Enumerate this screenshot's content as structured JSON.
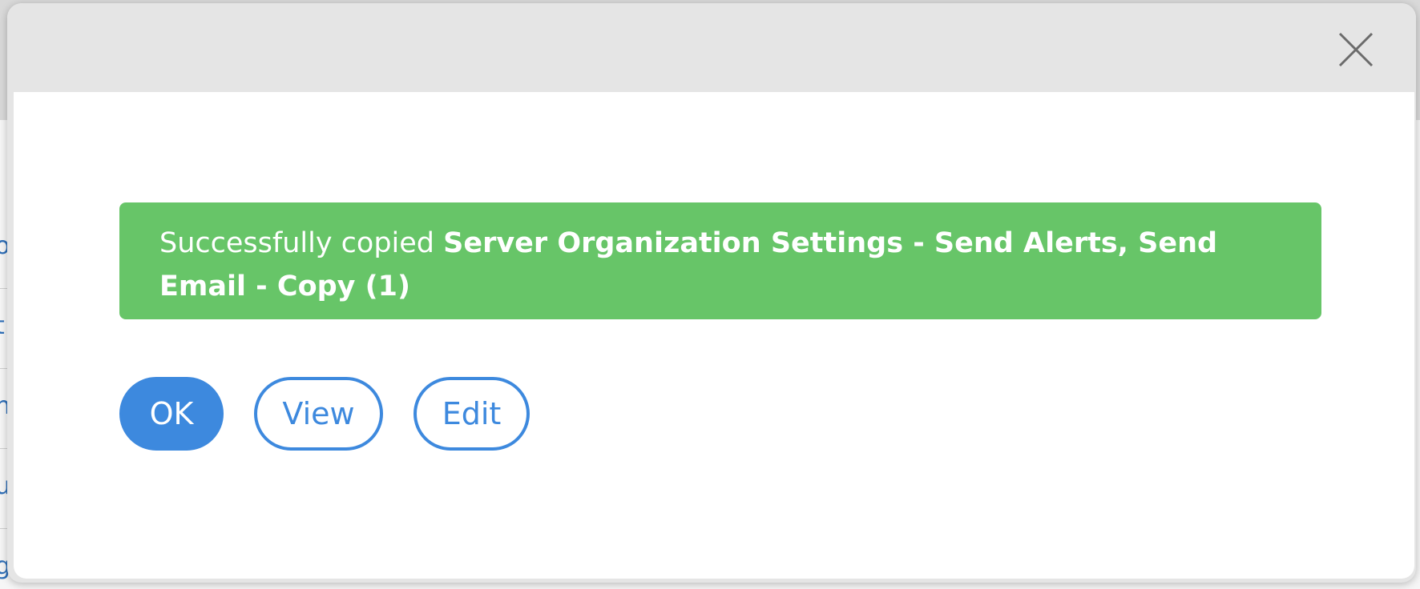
{
  "dialog": {
    "close_label": "×",
    "message": {
      "prefix": "Successfully copied ",
      "item_name": "Server Organization Settings - Send Alerts, Send Email - Copy (1)"
    },
    "buttons": {
      "ok": "OK",
      "view": "View",
      "edit": "Edit"
    }
  },
  "background": {
    "fragments": [
      "o",
      "t",
      "n",
      "u",
      "g"
    ]
  },
  "colors": {
    "success": "#67c568",
    "primary": "#3d89de",
    "header_bg": "#e5e5e5"
  },
  "icons": {
    "close": "close-icon"
  }
}
